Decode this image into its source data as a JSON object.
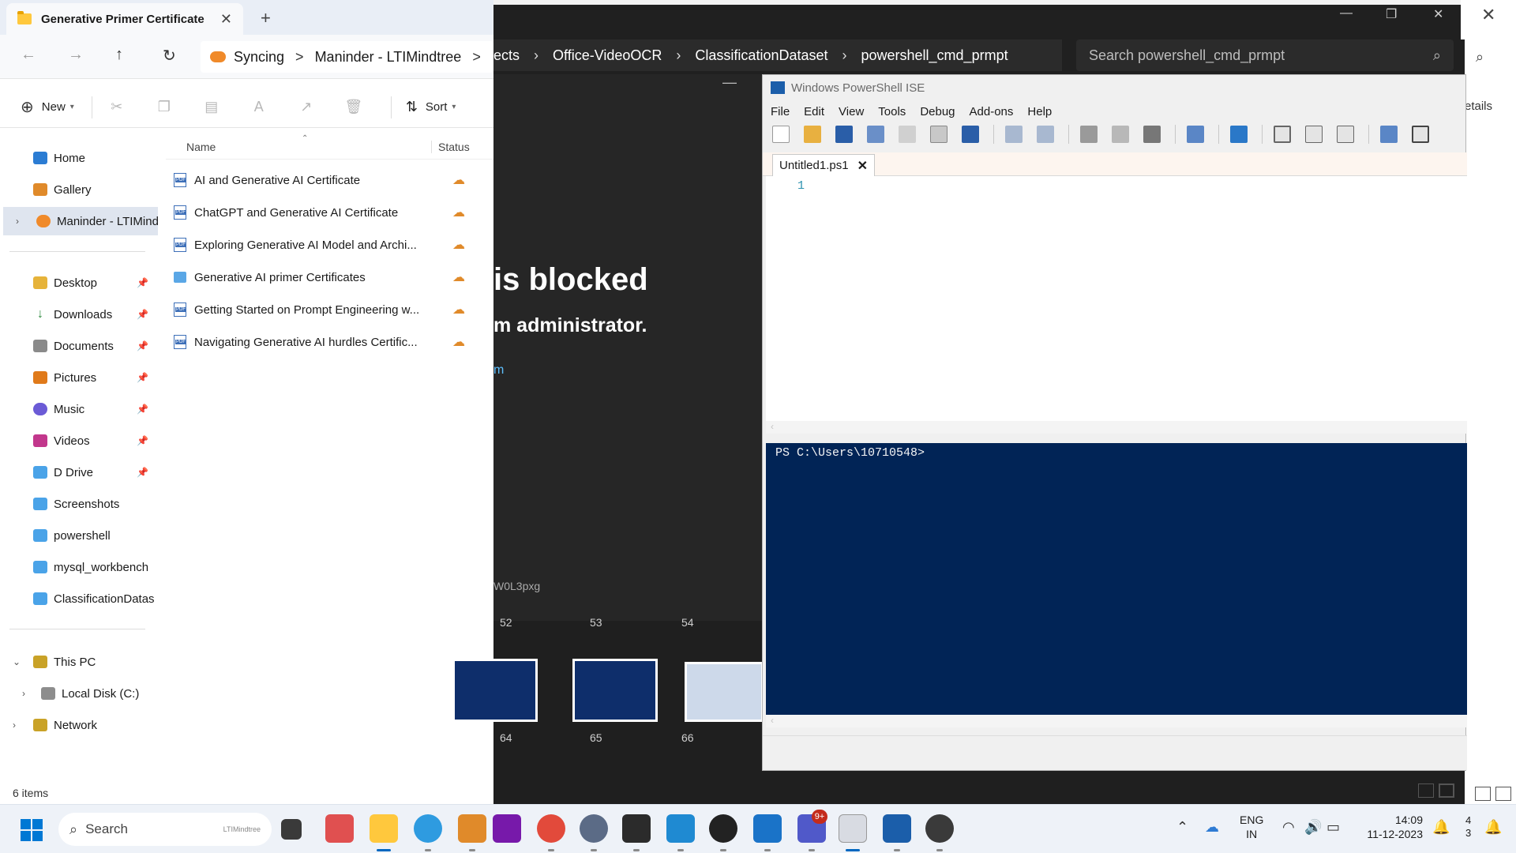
{
  "explorer": {
    "tab_title": "Generative Primer Certificate",
    "new_tab": "+",
    "address": {
      "sync_label": "Syncing",
      "location": "Maninder - LTIMindtree",
      "sep": ">"
    },
    "command_bar": {
      "new_label": "New",
      "sort_label": "Sort"
    },
    "sidebar": {
      "home": "Home",
      "gallery": "Gallery",
      "onedrive": "Maninder - LTIMindtree",
      "quick_access": [
        "Desktop",
        "Downloads",
        "Documents",
        "Pictures",
        "Music",
        "Videos",
        "D Drive",
        "Screenshots",
        "powershell",
        "mysql_workbench",
        "ClassificationDataset"
      ],
      "this_pc": "This PC",
      "local_disk": "Local Disk (C:)",
      "network": "Network"
    },
    "columns": {
      "name": "Name",
      "status": "Status"
    },
    "files": [
      {
        "name": "AI and Generative AI Certificate",
        "type": "pdf"
      },
      {
        "name": "ChatGPT and Generative AI Certificate",
        "type": "pdf"
      },
      {
        "name": "Exploring Generative AI Model and Archi...",
        "type": "pdf"
      },
      {
        "name": "Generative AI primer Certificates",
        "type": "folder"
      },
      {
        "name": "Getting Started on Prompt Engineering w...",
        "type": "pdf"
      },
      {
        "name": "Navigating Generative AI hurdles Certific...",
        "type": "pdf"
      }
    ],
    "status_count": "6 items"
  },
  "dark_window": {
    "breadcrumb": [
      "ects",
      "Office-VideoOCR",
      "ClassificationDataset",
      "powershell_cmd_prmpt"
    ],
    "search_placeholder": "Search powershell_cmd_prmpt",
    "blocked_title": "is blocked",
    "blocked_subtitle": "m administrator.",
    "blocked_link": "m",
    "blocked_code": "W0L3pxg",
    "thumb_numbers_top": [
      "52",
      "53",
      "54"
    ],
    "thumb_numbers_bottom": [
      "64",
      "65",
      "66"
    ],
    "details_label": "etails"
  },
  "ise": {
    "title": "Windows PowerShell ISE",
    "menu": [
      "File",
      "Edit",
      "View",
      "Tools",
      "Debug",
      "Add-ons",
      "Help"
    ],
    "tab": "Untitled1.ps1",
    "line_number": "1",
    "prompt": "PS C:\\Users\\10710548>"
  },
  "taskbar": {
    "search_label": "Search",
    "search_brand": "LTIMindtree",
    "teams_badge": "9+",
    "language": "ENG",
    "region": "IN",
    "time": "14:09",
    "date": "11-12-2023",
    "edge_text_1": "4",
    "edge_text_2": "3"
  },
  "colors": {
    "accent": "#0078d4",
    "console_bg": "#012456",
    "dark_bg": "#1f1f1f"
  }
}
